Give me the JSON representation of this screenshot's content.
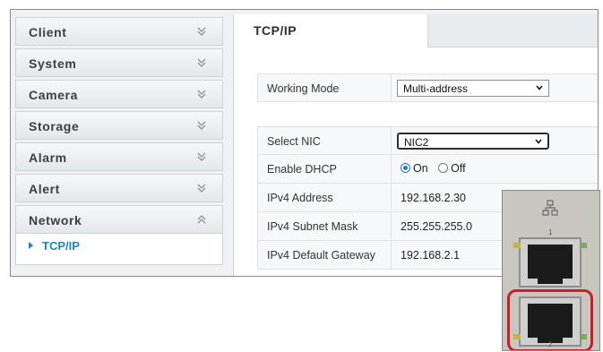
{
  "sidebar": {
    "items": [
      {
        "label": "Client",
        "chevron": "chevron-down-icon"
      },
      {
        "label": "System",
        "chevron": "chevron-down-icon"
      },
      {
        "label": "Camera",
        "chevron": "chevron-down-icon"
      },
      {
        "label": "Storage",
        "chevron": "chevron-down-icon"
      },
      {
        "label": "Alarm",
        "chevron": "chevron-down-icon"
      },
      {
        "label": "Alert",
        "chevron": "chevron-down-icon"
      },
      {
        "label": "Network",
        "chevron": "chevron-up-icon"
      }
    ],
    "sub_items": [
      {
        "label": "TCP/IP"
      }
    ]
  },
  "tab": {
    "label": "TCP/IP"
  },
  "form": {
    "working_mode": {
      "label": "Working Mode",
      "value": "Multi-address"
    },
    "select_nic": {
      "label": "Select NIC",
      "value": "NIC2"
    },
    "enable_dhcp": {
      "label": "Enable DHCP",
      "on_label": "On",
      "off_label": "Off",
      "selected": "On"
    },
    "ipv4_address": {
      "label": "IPv4 Address",
      "value": "192.168.2.30"
    },
    "ipv4_subnet_mask": {
      "label": "IPv4 Subnet Mask",
      "value": "255.255.255.0"
    },
    "ipv4_default_gateway": {
      "label": "IPv4 Default Gateway",
      "value": "192.168.2.1"
    }
  },
  "photo": {
    "port_labels": [
      "1",
      "2"
    ],
    "highlight_color": "#d11c26"
  },
  "colors": {
    "accent": "#1b86c7",
    "radio_selected": "#1e73d6"
  }
}
